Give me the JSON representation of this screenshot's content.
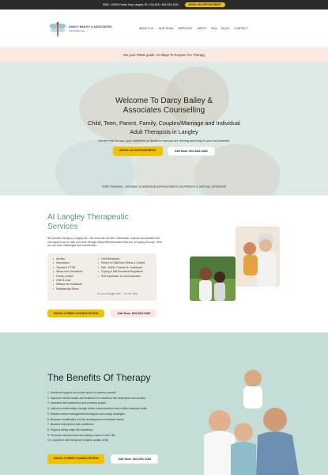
{
  "topbar": {
    "info": "8060 • 20039 Fraser Hwy Langley, BC V3A 4E6 • 604-533-1183",
    "button": "BOOK AN APPOINTMENT"
  },
  "logo": {
    "line1": "DARCY BAILEY & ASSOCIATES",
    "line2": "COUNSELLING"
  },
  "nav": {
    "items": [
      "ABOUT US",
      "OUR TEAM",
      "SERVICES",
      "RATES",
      "FAQ",
      "BLOG",
      "CONTACT"
    ]
  },
  "promo": {
    "text": "Get your FREE guide: 10 Ways To Prepare For Therapy"
  },
  "hero": {
    "title": "Welcome To Darcy Bailey & Associates Counselling",
    "subtitle": "Child, Teen, Parent, Family, Couples/Marriage and Individual Adult Therapists in Langley",
    "text": "Get the help for you, your child/teen or family so that you are thriving and living to your full potential.",
    "primary_button": "BOOK AN APPOINTMENT",
    "phone_button": "Call Now: 604-533-1183",
    "free_parking": "FREE PARKING - EVENING & WEEKEND APPOINTMENTS IN PERSON & VIRTUAL SESSIONS"
  },
  "therapeutic": {
    "title": "At Langley Therapeutic Services",
    "paragraph": "We provide therapy in Langley BC. We work with all teen, individuals, couples and families and can support you to help you work through many different issues that you are going through. Here are our main challenges and experiences:",
    "col1": [
      "Anxiety",
      "Depression",
      "Trauma & PTSD",
      "Stress and Overwhelm",
      "Family Conflict",
      "Grief & Loss",
      "Difficult Life transitions",
      "Relationship Stress"
    ],
    "col2": [
      "Child Behaviors",
      "Parent to Child/Teen Stress & Conflict",
      "Self - Worth / Esteem & Confidence",
      "Coping & Self Emotional Regulation",
      "Self Expression & Communication"
    ],
    "struggle": "Do you struggle with .. we can help",
    "primary_button": "BOOK A FREE CONSULTATION",
    "phone_button": "Call Now: 604-533-1183"
  },
  "benefits": {
    "title": "The Benefits Of Therapy",
    "items": [
      "1. Emotional support and a safe space to express oneself.",
      "2. Improved mental health and treatment for conditions like depression and anxiety.",
      "3. Increased self-awareness and personal growth.",
      "4. Improved relationships through better communication and conflict resolution skills.",
      "5. Effective stress management techniques and coping strategies.",
      "6. Behavior modification and the development of healthier habits.",
      "7. Boosted self-esteem and confidence.",
      "8. Support during major life transitions.",
      "9. Personal empowerment and taking control of one's life.",
      "10. Long-term well-being and a higher quality of life."
    ],
    "primary_button": "BOOK A FREE CONSULTATION",
    "phone_button": "Call Now: 604-533-1183"
  }
}
